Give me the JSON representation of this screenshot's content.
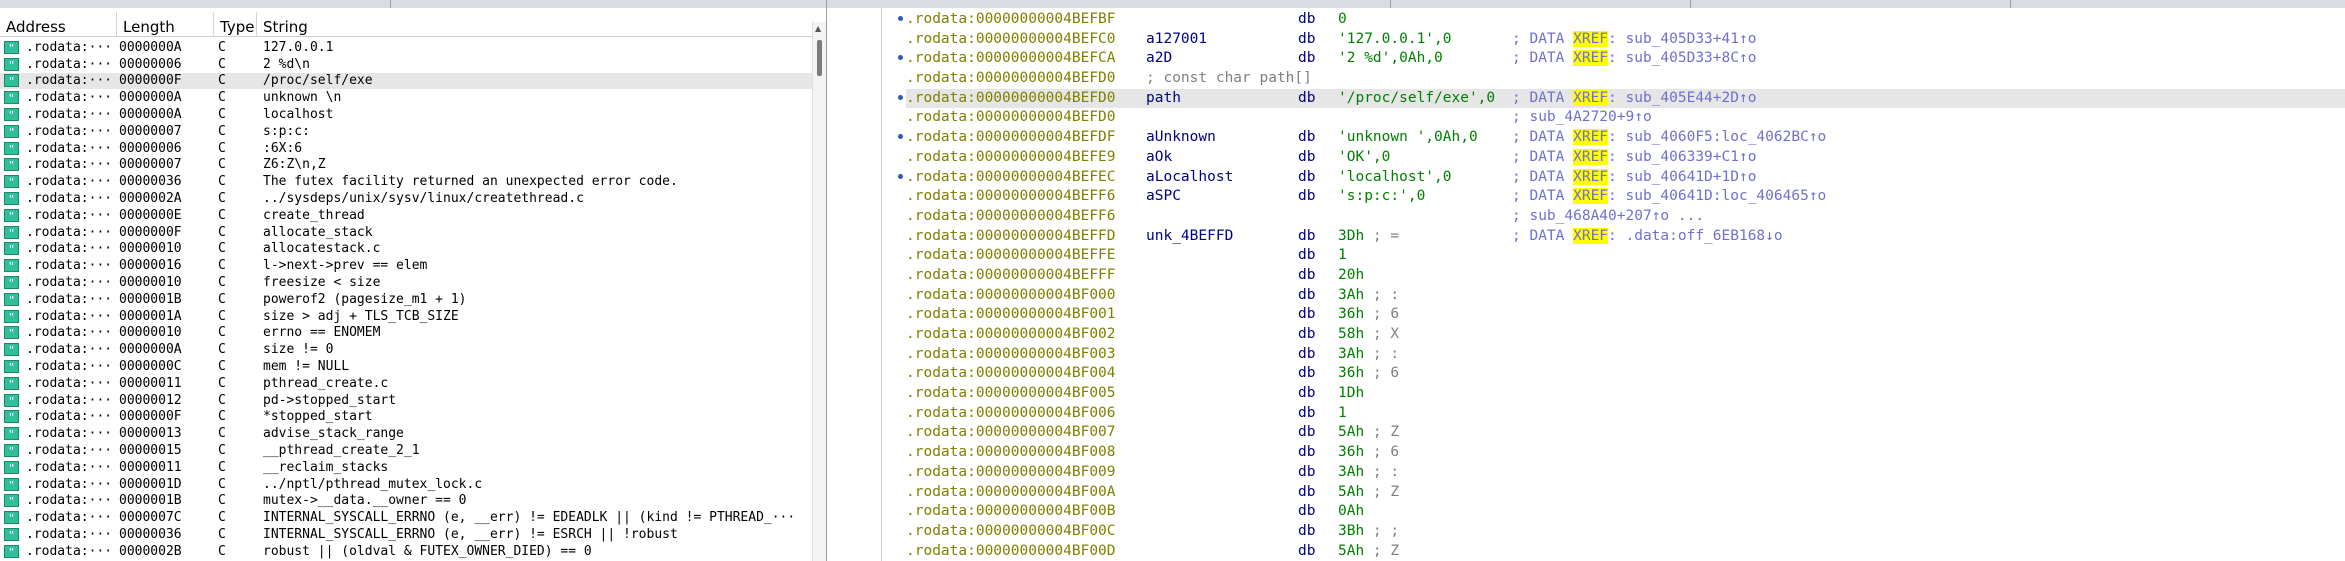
{
  "strings_window": {
    "columns": [
      "Address",
      "Length",
      "Type",
      "String"
    ],
    "rows": [
      {
        "addr": ".rodata:···",
        "len": "0000000A",
        "type": "C",
        "str": "127.0.0.1"
      },
      {
        "addr": ".rodata:···",
        "len": "00000006",
        "type": "C",
        "str": "2 %d\\n"
      },
      {
        "addr": ".rodata:···",
        "len": "0000000F",
        "type": "C",
        "str": "/proc/self/exe"
      },
      {
        "addr": ".rodata:···",
        "len": "0000000A",
        "type": "C",
        "str": "unknown \\n"
      },
      {
        "addr": ".rodata:···",
        "len": "0000000A",
        "type": "C",
        "str": "localhost"
      },
      {
        "addr": ".rodata:···",
        "len": "00000007",
        "type": "C",
        "str": "s:p:c:"
      },
      {
        "addr": ".rodata:···",
        "len": "00000006",
        "type": "C",
        "str": " :6X:6"
      },
      {
        "addr": ".rodata:···",
        "len": "00000007",
        "type": "C",
        "str": "Z6:Z\\n,Z"
      },
      {
        "addr": ".rodata:···",
        "len": "00000036",
        "type": "C",
        "str": "The futex facility returned an unexpected error code."
      },
      {
        "addr": ".rodata:···",
        "len": "0000002A",
        "type": "C",
        "str": "../sysdeps/unix/sysv/linux/createthread.c"
      },
      {
        "addr": ".rodata:···",
        "len": "0000000E",
        "type": "C",
        "str": "create_thread"
      },
      {
        "addr": ".rodata:···",
        "len": "0000000F",
        "type": "C",
        "str": "allocate_stack"
      },
      {
        "addr": ".rodata:···",
        "len": "00000010",
        "type": "C",
        "str": "allocatestack.c"
      },
      {
        "addr": ".rodata:···",
        "len": "00000016",
        "type": "C",
        "str": "l->next->prev == elem"
      },
      {
        "addr": ".rodata:···",
        "len": "00000010",
        "type": "C",
        "str": "freesize < size"
      },
      {
        "addr": ".rodata:···",
        "len": "0000001B",
        "type": "C",
        "str": "powerof2 (pagesize_m1 + 1)"
      },
      {
        "addr": ".rodata:···",
        "len": "0000001A",
        "type": "C",
        "str": "size > adj + TLS_TCB_SIZE"
      },
      {
        "addr": ".rodata:···",
        "len": "00000010",
        "type": "C",
        "str": "errno == ENOMEM"
      },
      {
        "addr": ".rodata:···",
        "len": "0000000A",
        "type": "C",
        "str": "size != 0"
      },
      {
        "addr": ".rodata:···",
        "len": "0000000C",
        "type": "C",
        "str": "mem != NULL"
      },
      {
        "addr": ".rodata:···",
        "len": "00000011",
        "type": "C",
        "str": "pthread_create.c"
      },
      {
        "addr": ".rodata:···",
        "len": "00000012",
        "type": "C",
        "str": "pd->stopped_start"
      },
      {
        "addr": ".rodata:···",
        "len": "0000000F",
        "type": "C",
        "str": "*stopped_start"
      },
      {
        "addr": ".rodata:···",
        "len": "00000013",
        "type": "C",
        "str": "advise_stack_range"
      },
      {
        "addr": ".rodata:···",
        "len": "00000015",
        "type": "C",
        "str": "__pthread_create_2_1"
      },
      {
        "addr": ".rodata:···",
        "len": "00000011",
        "type": "C",
        "str": "__reclaim_stacks"
      },
      {
        "addr": ".rodata:···",
        "len": "0000001D",
        "type": "C",
        "str": "../nptl/pthread_mutex_lock.c"
      },
      {
        "addr": ".rodata:···",
        "len": "0000001B",
        "type": "C",
        "str": "mutex->__data.__owner == 0"
      },
      {
        "addr": ".rodata:···",
        "len": "0000007C",
        "type": "C",
        "str": "INTERNAL_SYSCALL_ERRNO (e, __err) != EDEADLK || (kind != PTHREAD_···"
      },
      {
        "addr": ".rodata:···",
        "len": "00000036",
        "type": "C",
        "str": "INTERNAL_SYSCALL_ERRNO (e, __err) != ESRCH || !robust"
      },
      {
        "addr": ".rodata:···",
        "len": "0000002B",
        "type": "C",
        "str": "robust || (oldval & FUTEX_OWNER_DIED) == 0"
      }
    ],
    "icon_glyph": "\""
  },
  "disasm": {
    "rows": [
      {
        "addr": ".rodata:00000000004BEFBF",
        "label": "",
        "mn": "db",
        "op": "   0",
        "cmt": ""
      },
      {
        "addr": ".rodata:00000000004BEFC0",
        "label": "a127001",
        "mn": "db",
        "op": "'127.0.0.1',0",
        "cmt_pre": "; DATA ",
        "xref": "XREF",
        "cmt_post": ": sub_405D33+41↑o"
      },
      {
        "addr": ".rodata:00000000004BEFCA",
        "label": "a2D",
        "mn": "db",
        "op": "'2 %d',0Ah,0",
        "cmt_pre": "; DATA ",
        "xref": "XREF",
        "cmt_post": ": sub_405D33+8C↑o"
      },
      {
        "addr": ".rodata:00000000004BEFD0",
        "label": "; const char path[]",
        "mn": "",
        "op": "",
        "cmt": ""
      },
      {
        "addr": ".rodata:00000000004BEFD0",
        "label": "path",
        "mn": "db",
        "op": "'/proc/self/exe',0",
        "cmt_pre": "; DATA ",
        "xref": "XREF",
        "cmt_post": ": sub_405E44+2D↑o",
        "highlight": true
      },
      {
        "addr": ".rodata:00000000004BEFD0",
        "label": "",
        "mn": "",
        "op": "",
        "cmt": "; sub_4A2720+9↑o"
      },
      {
        "addr": ".rodata:00000000004BEFDF",
        "label": "aUnknown",
        "mn": "db",
        "op": "'unknown ',0Ah,0",
        "cmt_pre": "; DATA ",
        "xref": "XREF",
        "cmt_post": ": sub_4060F5:loc_4062BC↑o"
      },
      {
        "addr": ".rodata:00000000004BEFE9",
        "label": "aOk",
        "mn": "db",
        "op": "'OK',0",
        "cmt_pre": "; DATA ",
        "xref": "XREF",
        "cmt_post": ": sub_406339+C1↑o"
      },
      {
        "addr": ".rodata:00000000004BEFEC",
        "label": "aLocalhost",
        "mn": "db",
        "op": "'localhost',0",
        "cmt_pre": "; DATA ",
        "xref": "XREF",
        "cmt_post": ": sub_40641D+1D↑o"
      },
      {
        "addr": ".rodata:00000000004BEFF6",
        "label": "aSPC",
        "mn": "db",
        "op": "'s:p:c:',0",
        "cmt_pre": "; DATA ",
        "xref": "XREF",
        "cmt_post": ": sub_40641D:loc_406465↑o"
      },
      {
        "addr": ".rodata:00000000004BEFF6",
        "label": "",
        "mn": "",
        "op": "",
        "cmt": "; sub_468A40+207↑o ..."
      },
      {
        "addr": ".rodata:00000000004BEFFD",
        "label": "unk_4BEFFD",
        "mn": "db",
        "op": "3Dh",
        "opcmt": " ; =",
        "cmt_pre": "; DATA ",
        "xref": "XREF",
        "cmt_post": ": .data:off_6EB168↓o"
      },
      {
        "addr": ".rodata:00000000004BEFFE",
        "label": "",
        "mn": "db",
        "op": "   1",
        "cmt": ""
      },
      {
        "addr": ".rodata:00000000004BEFFF",
        "label": "",
        "mn": "db",
        "op": "20h",
        "cmt": ""
      },
      {
        "addr": ".rodata:00000000004BF000",
        "label": "",
        "mn": "db",
        "op": "3Ah",
        "opcmt": " ; :",
        "cmt": ""
      },
      {
        "addr": ".rodata:00000000004BF001",
        "label": "",
        "mn": "db",
        "op": "36h",
        "opcmt": " ; 6",
        "cmt": ""
      },
      {
        "addr": ".rodata:00000000004BF002",
        "label": "",
        "mn": "db",
        "op": "58h",
        "opcmt": " ; X",
        "cmt": ""
      },
      {
        "addr": ".rodata:00000000004BF003",
        "label": "",
        "mn": "db",
        "op": "3Ah",
        "opcmt": " ; :",
        "cmt": ""
      },
      {
        "addr": ".rodata:00000000004BF004",
        "label": "",
        "mn": "db",
        "op": "36h",
        "opcmt": " ; 6",
        "cmt": ""
      },
      {
        "addr": ".rodata:00000000004BF005",
        "label": "",
        "mn": "db",
        "op": "1Dh",
        "cmt": ""
      },
      {
        "addr": ".rodata:00000000004BF006",
        "label": "",
        "mn": "db",
        "op": "   1",
        "cmt": ""
      },
      {
        "addr": ".rodata:00000000004BF007",
        "label": "",
        "mn": "db",
        "op": "5Ah",
        "opcmt": " ; Z",
        "cmt": ""
      },
      {
        "addr": ".rodata:00000000004BF008",
        "label": "",
        "mn": "db",
        "op": "36h",
        "opcmt": " ; 6",
        "cmt": ""
      },
      {
        "addr": ".rodata:00000000004BF009",
        "label": "",
        "mn": "db",
        "op": "3Ah",
        "opcmt": " ; :",
        "cmt": ""
      },
      {
        "addr": ".rodata:00000000004BF00A",
        "label": "",
        "mn": "db",
        "op": "5Ah",
        "opcmt": " ; Z",
        "cmt": ""
      },
      {
        "addr": ".rodata:00000000004BF00B",
        "label": "",
        "mn": "db",
        "op": "0Ah",
        "cmt": ""
      },
      {
        "addr": ".rodata:00000000004BF00C",
        "label": "",
        "mn": "db",
        "op": "3Bh",
        "opcmt": " ; ;",
        "cmt": ""
      },
      {
        "addr": ".rodata:00000000004BF00D",
        "label": "",
        "mn": "db",
        "op": "5Ah",
        "opcmt": " ; Z",
        "cmt": ""
      }
    ]
  },
  "colors": {
    "address_segment": "#808000",
    "label": "#000080",
    "operand": "#008000",
    "xref_comment": "#7070d0",
    "xref_highlight": "#ffff00",
    "string_icon": "#2fbf9a"
  }
}
